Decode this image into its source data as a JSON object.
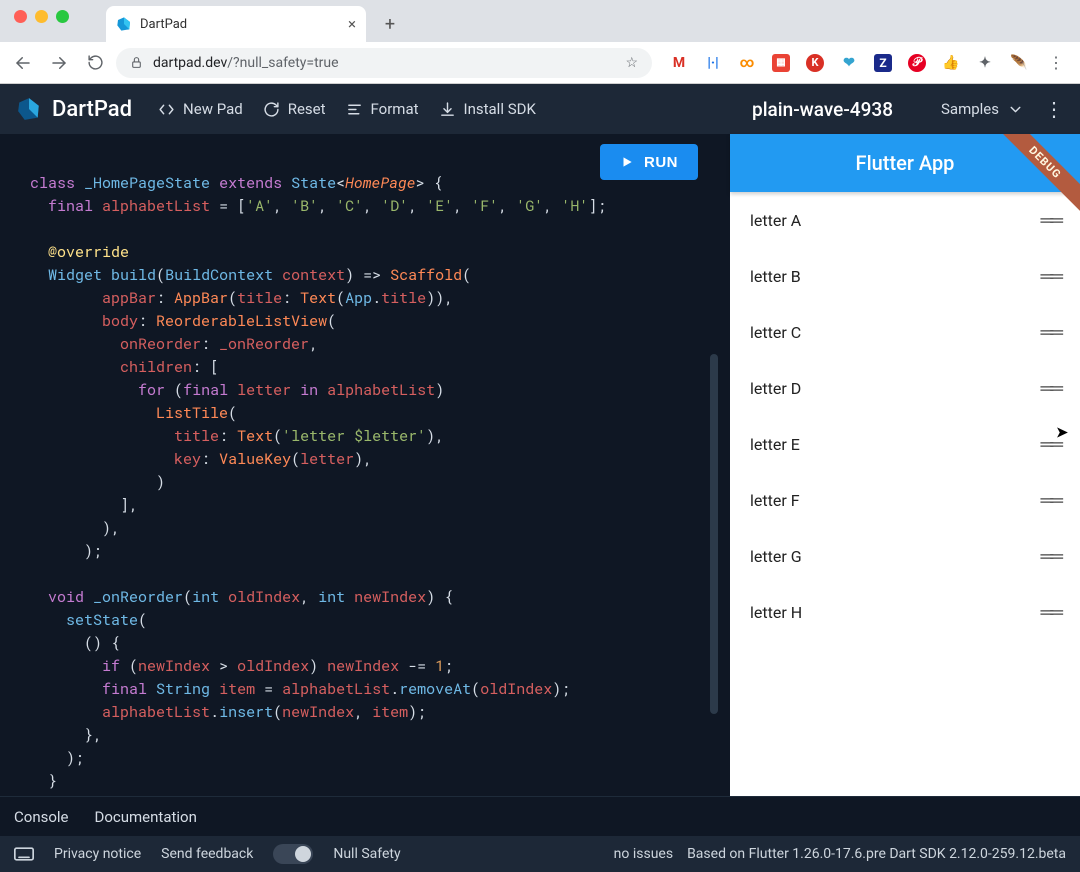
{
  "browser": {
    "tab_title": "DartPad",
    "url_prefix": "dartpad.dev",
    "url_path": "/?null_safety=true"
  },
  "topbar": {
    "brand": "DartPad",
    "new_pad": "New Pad",
    "reset": "Reset",
    "format": "Format",
    "install_sdk": "Install SDK",
    "pad_title": "plain-wave-4938",
    "samples": "Samples"
  },
  "run_button": "RUN",
  "code_lines": [
    [
      [
        "kw",
        "class"
      ],
      [
        "pun",
        " "
      ],
      [
        "cls",
        "_HomePageState"
      ],
      [
        "pun",
        " "
      ],
      [
        "kw",
        "extends"
      ],
      [
        "pun",
        " "
      ],
      [
        "cls",
        "State"
      ],
      [
        "pun",
        "<"
      ],
      [
        "typ",
        "HomePage"
      ],
      [
        "pun",
        "> {"
      ]
    ],
    [
      [
        "pun",
        "  "
      ],
      [
        "kw",
        "final"
      ],
      [
        "pun",
        " "
      ],
      [
        "id",
        "alphabetList"
      ],
      [
        "pun",
        " = ["
      ],
      [
        "str",
        "'A'"
      ],
      [
        "pun",
        ", "
      ],
      [
        "str",
        "'B'"
      ],
      [
        "pun",
        ", "
      ],
      [
        "str",
        "'C'"
      ],
      [
        "pun",
        ", "
      ],
      [
        "str",
        "'D'"
      ],
      [
        "pun",
        ", "
      ],
      [
        "str",
        "'E'"
      ],
      [
        "pun",
        ", "
      ],
      [
        "str",
        "'F'"
      ],
      [
        "pun",
        ", "
      ],
      [
        "str",
        "'G'"
      ],
      [
        "pun",
        ", "
      ],
      [
        "str",
        "'H'"
      ],
      [
        "pun",
        "];"
      ]
    ],
    [],
    [
      [
        "pun",
        "  "
      ],
      [
        "ov",
        "@override"
      ]
    ],
    [
      [
        "pun",
        "  "
      ],
      [
        "cls",
        "Widget"
      ],
      [
        "pun",
        " "
      ],
      [
        "fn",
        "build"
      ],
      [
        "pun",
        "("
      ],
      [
        "cls",
        "BuildContext"
      ],
      [
        "pun",
        " "
      ],
      [
        "id",
        "context"
      ],
      [
        "pun",
        ") => "
      ],
      [
        "call",
        "Scaffold"
      ],
      [
        "pun",
        "("
      ]
    ],
    [
      [
        "pun",
        "        "
      ],
      [
        "id",
        "appBar"
      ],
      [
        "pun",
        ": "
      ],
      [
        "call",
        "AppBar"
      ],
      [
        "pun",
        "("
      ],
      [
        "id",
        "title"
      ],
      [
        "pun",
        ": "
      ],
      [
        "call",
        "Text"
      ],
      [
        "pun",
        "("
      ],
      [
        "cls",
        "App"
      ],
      [
        "pun",
        "."
      ],
      [
        "id",
        "title"
      ],
      [
        "pun",
        ")),"
      ]
    ],
    [
      [
        "pun",
        "        "
      ],
      [
        "id",
        "body"
      ],
      [
        "pun",
        ": "
      ],
      [
        "call",
        "ReorderableListView"
      ],
      [
        "pun",
        "("
      ]
    ],
    [
      [
        "pun",
        "          "
      ],
      [
        "id",
        "onReorder"
      ],
      [
        "pun",
        ": "
      ],
      [
        "id",
        "_onReorder"
      ],
      [
        "pun",
        ","
      ]
    ],
    [
      [
        "pun",
        "          "
      ],
      [
        "id",
        "children"
      ],
      [
        "pun",
        ": ["
      ]
    ],
    [
      [
        "pun",
        "            "
      ],
      [
        "kw",
        "for"
      ],
      [
        "pun",
        " ("
      ],
      [
        "kw",
        "final"
      ],
      [
        "pun",
        " "
      ],
      [
        "id",
        "letter"
      ],
      [
        "pun",
        " "
      ],
      [
        "kw",
        "in"
      ],
      [
        "pun",
        " "
      ],
      [
        "id",
        "alphabetList"
      ],
      [
        "pun",
        ")"
      ]
    ],
    [
      [
        "pun",
        "              "
      ],
      [
        "call",
        "ListTile"
      ],
      [
        "pun",
        "("
      ]
    ],
    [
      [
        "pun",
        "                "
      ],
      [
        "id",
        "title"
      ],
      [
        "pun",
        ": "
      ],
      [
        "call",
        "Text"
      ],
      [
        "pun",
        "("
      ],
      [
        "str",
        "'letter $letter'"
      ],
      [
        "pun",
        "),"
      ]
    ],
    [
      [
        "pun",
        "                "
      ],
      [
        "id",
        "key"
      ],
      [
        "pun",
        ": "
      ],
      [
        "call",
        "ValueKey"
      ],
      [
        "pun",
        "("
      ],
      [
        "id",
        "letter"
      ],
      [
        "pun",
        "),"
      ]
    ],
    [
      [
        "pun",
        "              )"
      ]
    ],
    [
      [
        "pun",
        "          ],"
      ]
    ],
    [
      [
        "pun",
        "        ),"
      ]
    ],
    [
      [
        "pun",
        "      );"
      ]
    ],
    [],
    [
      [
        "pun",
        "  "
      ],
      [
        "kw",
        "void"
      ],
      [
        "pun",
        " "
      ],
      [
        "fn",
        "_onReorder"
      ],
      [
        "pun",
        "("
      ],
      [
        "cls",
        "int"
      ],
      [
        "pun",
        " "
      ],
      [
        "id",
        "oldIndex"
      ],
      [
        "pun",
        ", "
      ],
      [
        "cls",
        "int"
      ],
      [
        "pun",
        " "
      ],
      [
        "id",
        "newIndex"
      ],
      [
        "pun",
        ") {"
      ]
    ],
    [
      [
        "pun",
        "    "
      ],
      [
        "fn",
        "setState"
      ],
      [
        "pun",
        "("
      ]
    ],
    [
      [
        "pun",
        "      () {"
      ]
    ],
    [
      [
        "pun",
        "        "
      ],
      [
        "kw",
        "if"
      ],
      [
        "pun",
        " ("
      ],
      [
        "id",
        "newIndex"
      ],
      [
        "pun",
        " > "
      ],
      [
        "id",
        "oldIndex"
      ],
      [
        "pun",
        ") "
      ],
      [
        "id",
        "newIndex"
      ],
      [
        "pun",
        " -= "
      ],
      [
        "num",
        "1"
      ],
      [
        "pun",
        ";"
      ]
    ],
    [
      [
        "pun",
        "        "
      ],
      [
        "kw",
        "final"
      ],
      [
        "pun",
        " "
      ],
      [
        "cls",
        "String"
      ],
      [
        "pun",
        " "
      ],
      [
        "id",
        "item"
      ],
      [
        "pun",
        " = "
      ],
      [
        "id",
        "alphabetList"
      ],
      [
        "pun",
        "."
      ],
      [
        "fn",
        "removeAt"
      ],
      [
        "pun",
        "("
      ],
      [
        "id",
        "oldIndex"
      ],
      [
        "pun",
        ");"
      ]
    ],
    [
      [
        "pun",
        "        "
      ],
      [
        "id",
        "alphabetList"
      ],
      [
        "pun",
        "."
      ],
      [
        "fn",
        "insert"
      ],
      [
        "pun",
        "("
      ],
      [
        "id",
        "newIndex"
      ],
      [
        "pun",
        ", "
      ],
      [
        "id",
        "item"
      ],
      [
        "pun",
        ");"
      ]
    ],
    [
      [
        "pun",
        "      },"
      ]
    ],
    [
      [
        "pun",
        "    );"
      ]
    ],
    [
      [
        "pun",
        "  }"
      ]
    ],
    [
      [
        "pun",
        "}"
      ]
    ]
  ],
  "preview": {
    "appbar_title": "Flutter App",
    "debug": "DEBUG",
    "letters": [
      "letter A",
      "letter B",
      "letter C",
      "letter D",
      "letter E",
      "letter F",
      "letter G",
      "letter H"
    ]
  },
  "bottom_tabs": {
    "console": "Console",
    "documentation": "Documentation"
  },
  "status": {
    "privacy": "Privacy notice",
    "feedback": "Send feedback",
    "null_safety": "Null Safety",
    "issues": "no issues",
    "version": "Based on Flutter 1.26.0-17.6.pre Dart SDK 2.12.0-259.12.beta"
  }
}
